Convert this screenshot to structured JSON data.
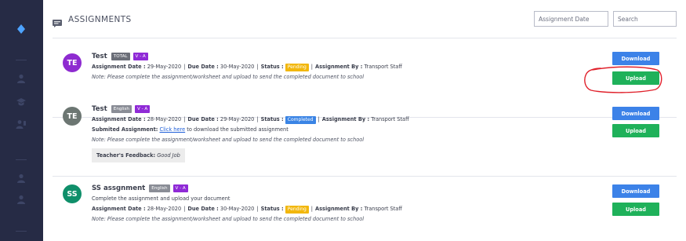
{
  "page": {
    "title": "ASSIGNMENTS",
    "date_filter_placeholder": "Assignment Date",
    "search_placeholder": "Search"
  },
  "labels": {
    "assignment_date": "Assignment Date :",
    "due_date": "Due Date :",
    "status": "Status :",
    "assignment_by": "Assignment By :",
    "submitted": "Submited Assignment:",
    "click_here": "Click here",
    "submitted_rest": "to download the submitted assignment",
    "feedback": "Teacher's Feedback:",
    "download": "Download",
    "upload": "Upload"
  },
  "assignments": [
    {
      "avatar": "TE",
      "avatar_color": "#8e2bd0",
      "title": "Test",
      "subject": "TOTAL",
      "class": "V - A",
      "assignment_date": "29-May-2020",
      "due_date": "30-May-2020",
      "status": "Pending",
      "status_color": "#f2b70c",
      "assignment_by": "Transport Staff",
      "note": "Note: Please complete the assignment/worksheet and upload to send the completed document to school"
    },
    {
      "avatar": "TE",
      "avatar_color": "#6c7672",
      "title": "Test",
      "subject": "English",
      "class": "V - A",
      "assignment_date": "28-May-2020",
      "due_date": "29-May-2020",
      "status": "Completed",
      "status_color": "#3a84e5",
      "assignment_by": "Transport Staff",
      "note": "Note: Please complete the assignment/worksheet and upload to send the completed document to school",
      "feedback": "Good Job"
    },
    {
      "avatar": "SS",
      "avatar_color": "#0f8f6a",
      "title": "SS assgnment",
      "subject": "English",
      "class": "V - A",
      "description": "Complete the assignment and upload your document",
      "assignment_date": "28-May-2020",
      "due_date": "30-May-2020",
      "status": "Pending",
      "status_color": "#f2b70c",
      "assignment_by": "Transport Staff",
      "note": "Note: Please complete the assignment/worksheet and upload to send the completed document to school"
    }
  ],
  "colors": {
    "sidebar": "#262b45",
    "download": "#3c82e8",
    "upload": "#1fb15a",
    "annotation": "#e0202a"
  }
}
